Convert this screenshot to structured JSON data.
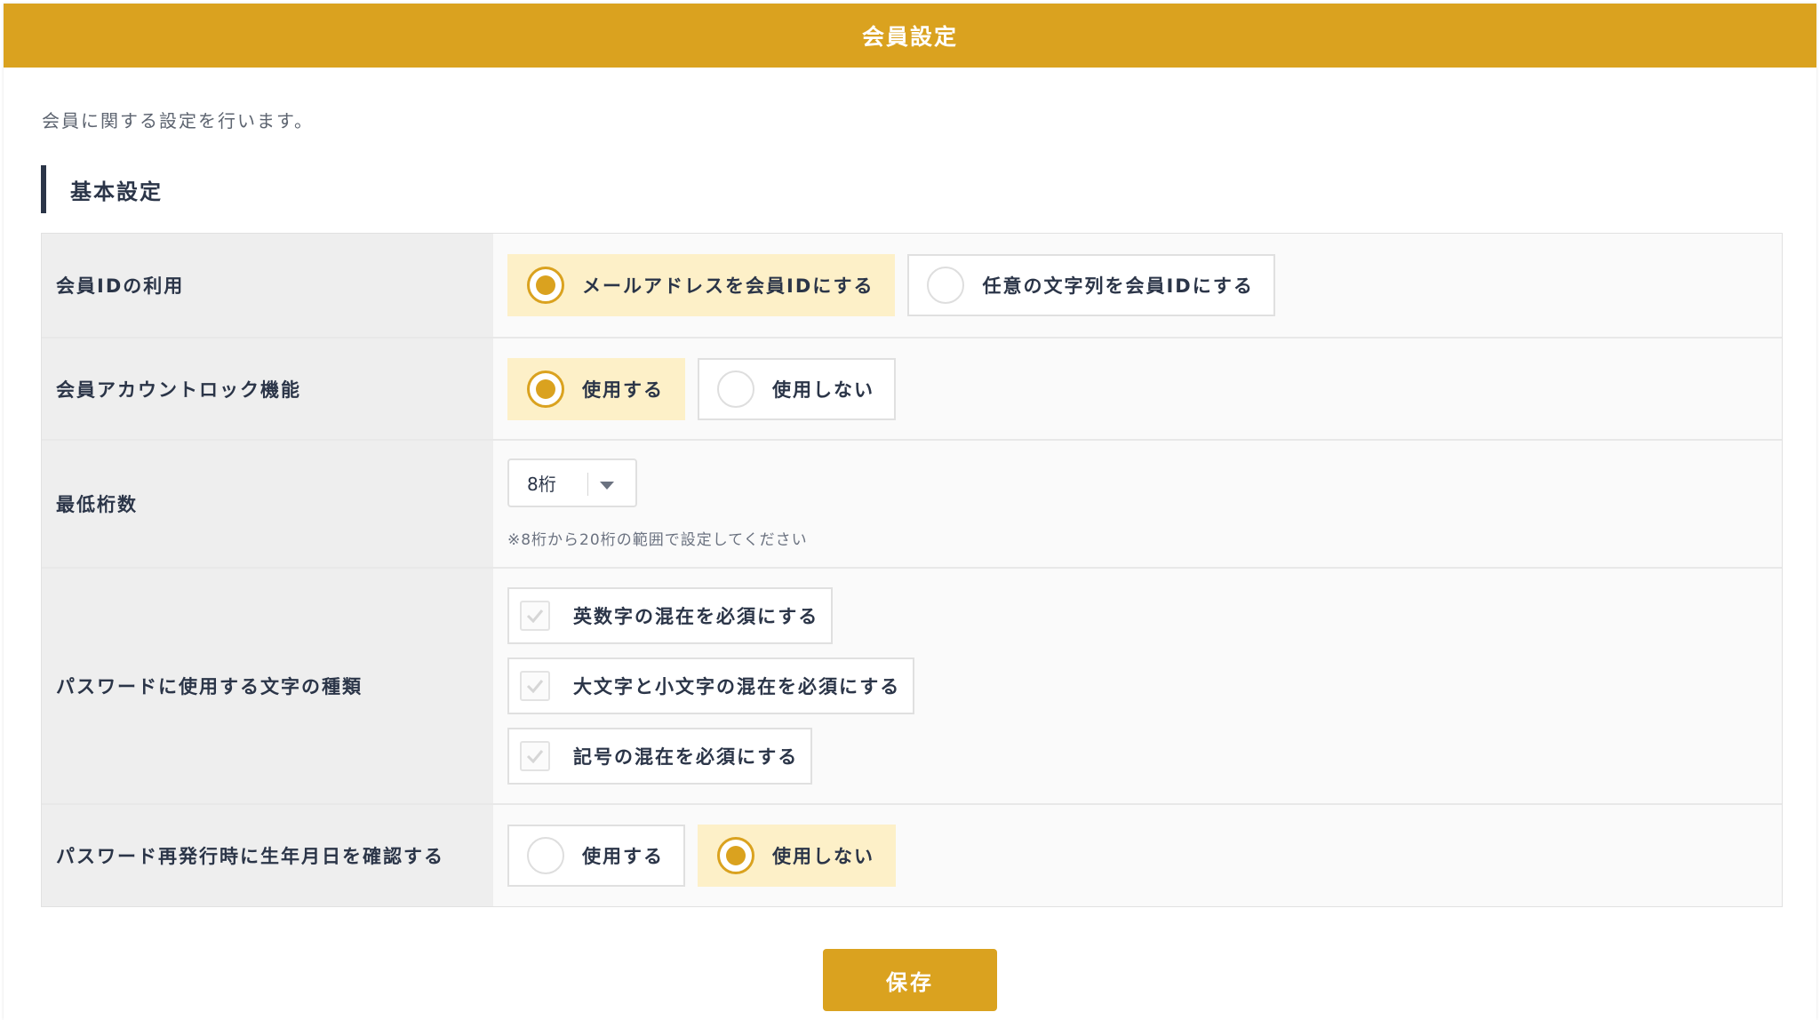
{
  "header": {
    "title": "会員設定"
  },
  "intro": "会員に関する設定を行います。",
  "section": {
    "title": "基本設定"
  },
  "member_id": {
    "label": "会員IDの利用",
    "options": [
      "メールアドレスを会員IDにする",
      "任意の文字列を会員IDにする"
    ],
    "selected_index": 0
  },
  "account_lock": {
    "label": "会員アカウントロック機能",
    "options": [
      "使用する",
      "使用しない"
    ],
    "selected_index": 0
  },
  "min_digits": {
    "label": "最低桁数",
    "value": "8桁",
    "note": "※8桁から20桁の範囲で設定してください"
  },
  "password_chars": {
    "label": "パスワードに使用する文字の種類",
    "options": [
      "英数字の混在を必須にする",
      "大文字と小文字の混在を必須にする",
      "記号の混在を必須にする"
    ]
  },
  "birth_confirm": {
    "label": "パスワード再発行時に生年月日を確認する",
    "options": [
      "使用する",
      "使用しない"
    ],
    "selected_index": 1
  },
  "save_label": "保存",
  "colors": {
    "accent": "#daa21f",
    "selected_bg": "#fdf0c8",
    "text": "#2b3548"
  }
}
